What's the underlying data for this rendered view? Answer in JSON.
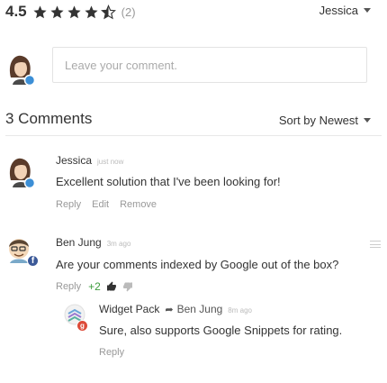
{
  "rating": {
    "value": "4.5",
    "count": "(2)",
    "stars": [
      "full",
      "full",
      "full",
      "full",
      "half"
    ],
    "star_color": "#333333"
  },
  "user_menu": {
    "name": "Jessica"
  },
  "composer": {
    "placeholder": "Leave your comment."
  },
  "comments_header": {
    "count_label": "3 Comments",
    "sort_label": "Sort by Newest"
  },
  "comments": [
    {
      "author": "Jessica",
      "time": "just now",
      "text": "Excellent solution that I've been looking for!",
      "actions": [
        "Reply",
        "Edit",
        "Remove"
      ]
    },
    {
      "author": "Ben Jung",
      "time": "3m ago",
      "text": "Are your comments indexed by Google out of the box?",
      "reply_label": "Reply",
      "votes": "+2"
    },
    {
      "author": "Widget Pack",
      "reply_to": "Ben Jung",
      "time": "8m ago",
      "text": "Sure, also supports Google Snippets for rating.",
      "reply_label": "Reply"
    }
  ],
  "colors": {
    "accent_blue": "#3c8fd6",
    "facebook_blue": "#3b5998",
    "vote_green": "#3c9b3c",
    "muted": "#999999"
  }
}
